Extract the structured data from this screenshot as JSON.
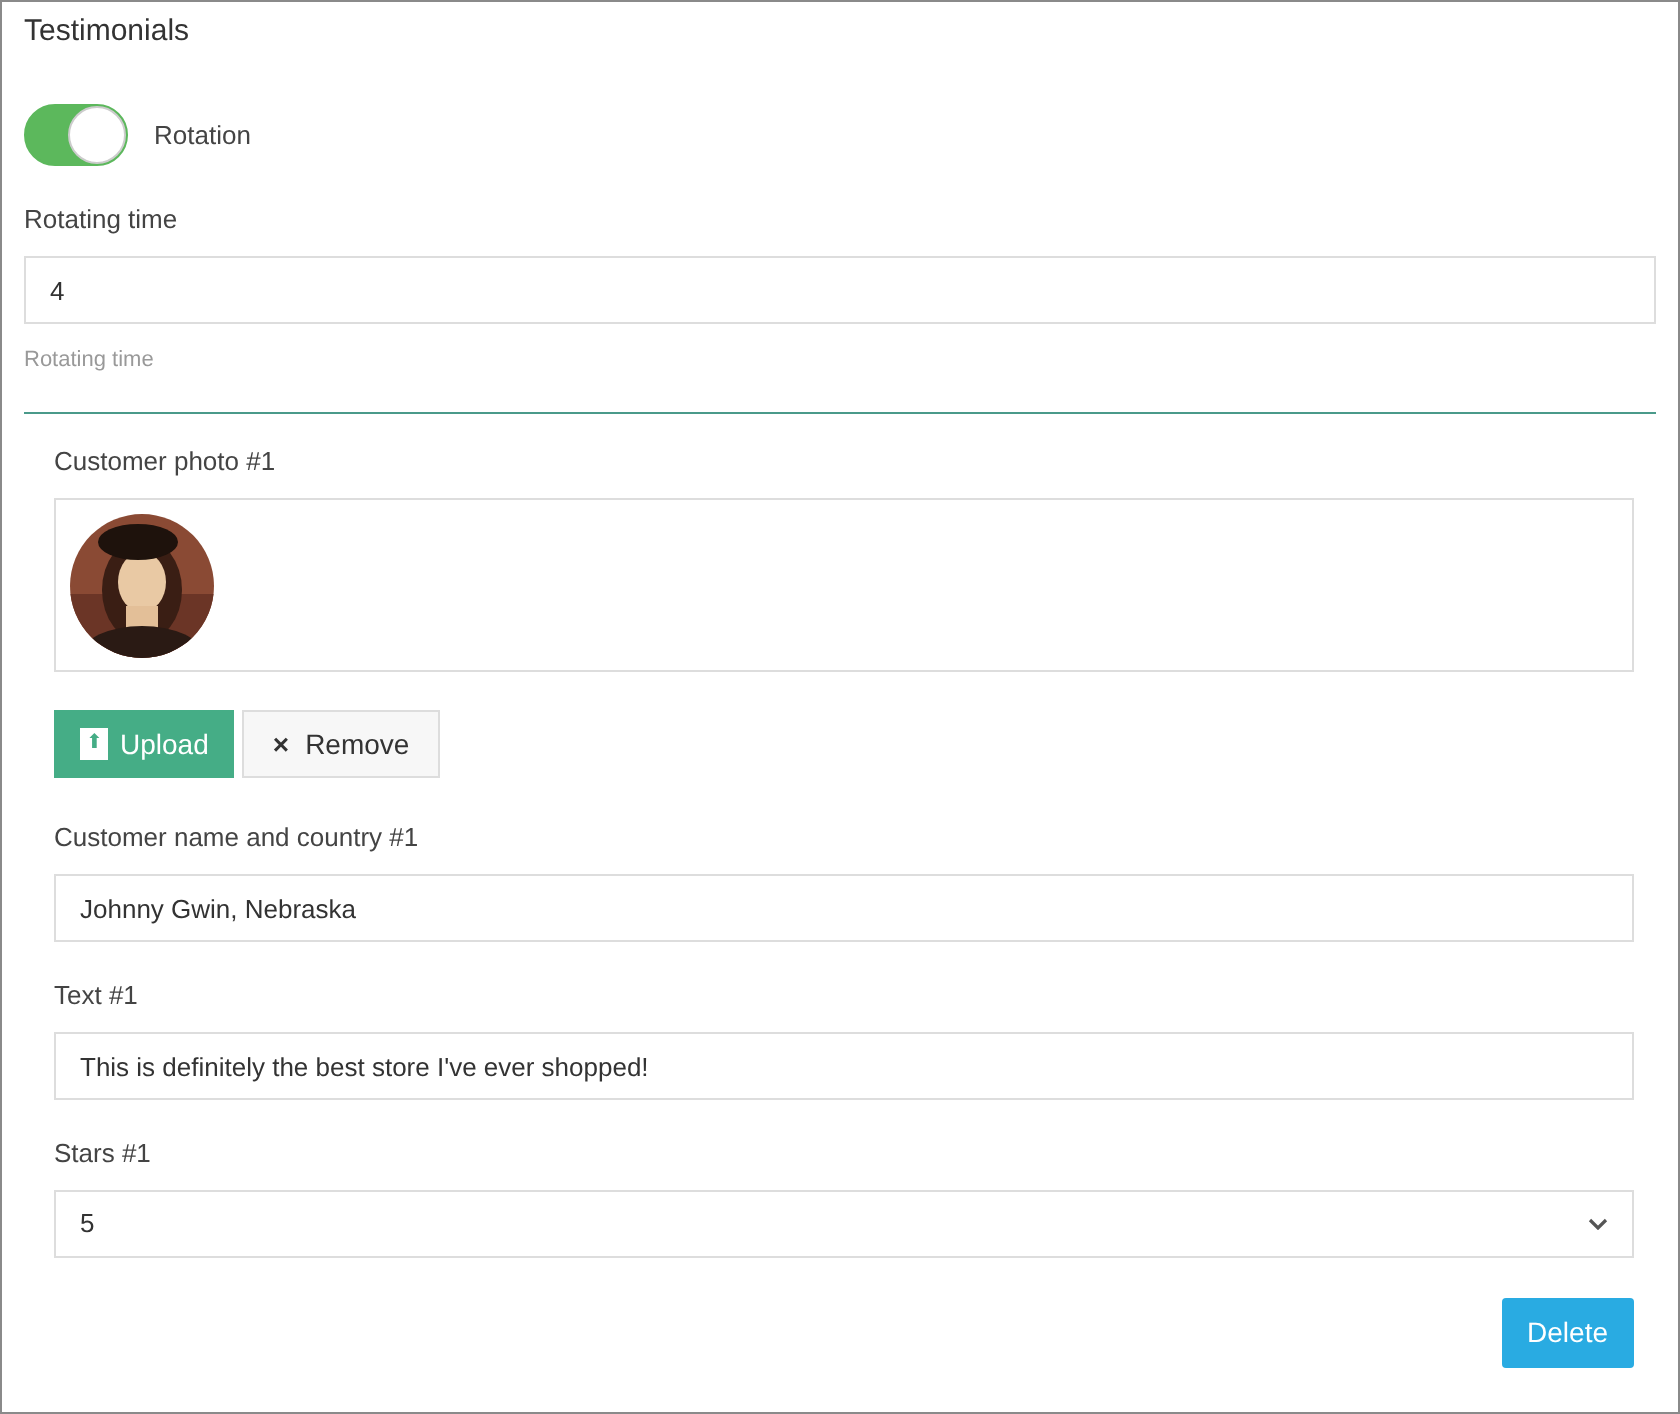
{
  "title": "Testimonials",
  "rotation": {
    "label": "Rotation",
    "on": true
  },
  "rotating_time": {
    "label": "Rotating time",
    "value": "4",
    "help": "Rotating time"
  },
  "testimonial": {
    "photo_label": "Customer photo #1",
    "upload_button": {
      "icon": "⬆",
      "label": "Upload"
    },
    "remove_button": {
      "icon": "×",
      "label": "Remove"
    },
    "fields": [
      {
        "kind": "text",
        "label": "Customer name and country #1",
        "value": "Johnny Gwin, Nebraska"
      },
      {
        "kind": "text",
        "label": "Text #1",
        "value": "This is definitely the best store I've ever shopped!"
      },
      {
        "kind": "select",
        "label": "Stars #1",
        "value": "5"
      }
    ],
    "delete_button": "Delete"
  }
}
